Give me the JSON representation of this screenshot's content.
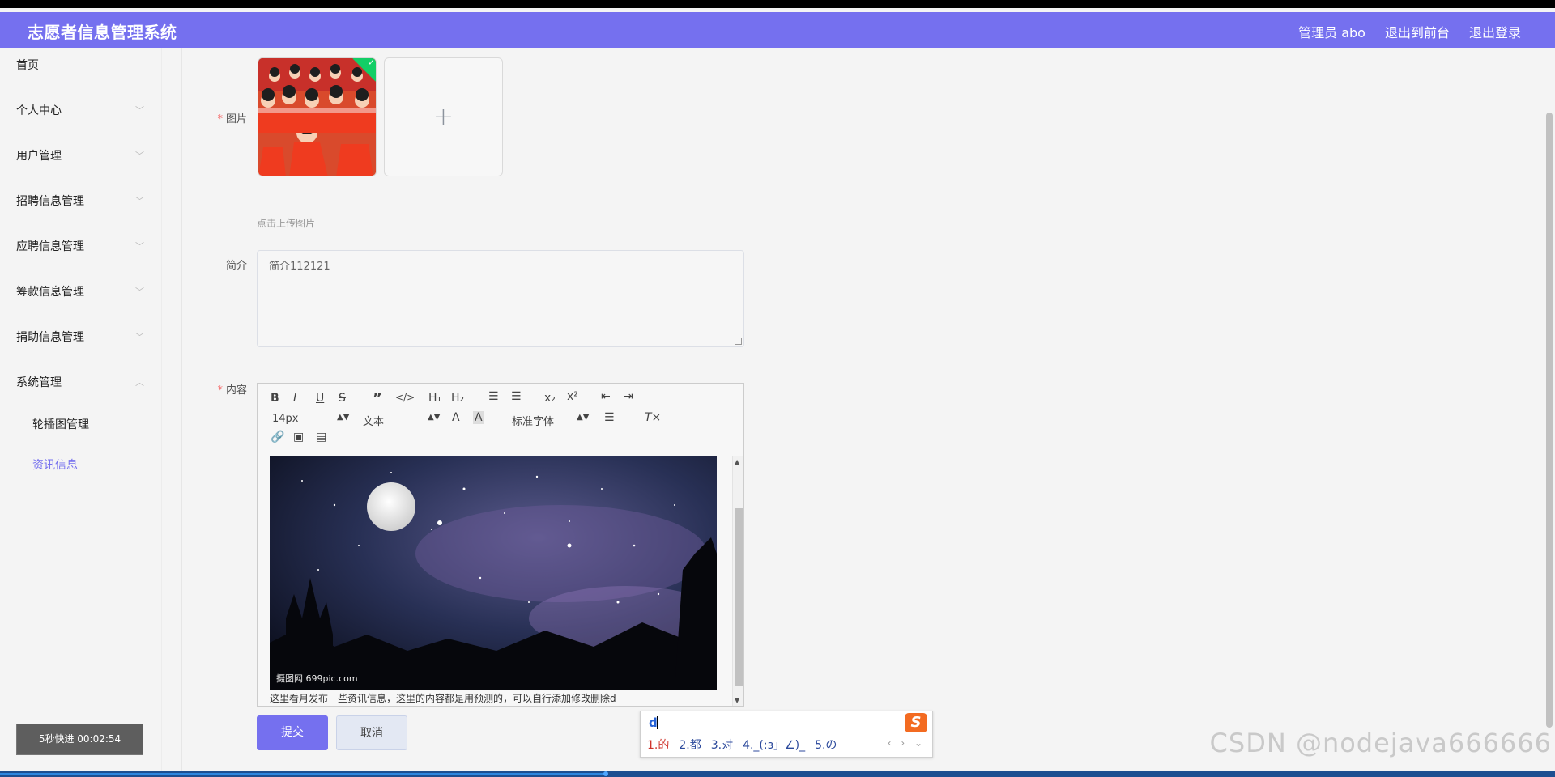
{
  "header": {
    "title": "志愿者信息管理系统",
    "admin": "管理员 abo",
    "to_frontend": "退出到前台",
    "logout": "退出登录"
  },
  "sidebar": {
    "items": [
      {
        "label": "首页"
      },
      {
        "label": "个人中心"
      },
      {
        "label": "用户管理"
      },
      {
        "label": "招聘信息管理"
      },
      {
        "label": "应聘信息管理"
      },
      {
        "label": "筹款信息管理"
      },
      {
        "label": "捐助信息管理"
      },
      {
        "label": "系统管理"
      },
      {
        "label": "轮播图管理"
      },
      {
        "label": "资讯信息"
      }
    ]
  },
  "timer": "5秒快进    00:02:54",
  "form": {
    "image_label": "图片",
    "upload_tip": "点击上传图片",
    "uploader_plus": "+",
    "intro_label": "简介",
    "intro_value": "简介112121",
    "content_label": "内容",
    "required_mark": "*"
  },
  "editor": {
    "font_size": "14px",
    "paragraph": "文本",
    "font_family": "标准字体",
    "image_watermark": "摄图网 699pic.com",
    "caption": "这里看月发布一些资讯信息，这里的内容都是用预测的，可以自行添加修改删除d"
  },
  "buttons": {
    "submit": "提交",
    "cancel": "取消"
  },
  "ime": {
    "typed": "d",
    "candidates": [
      "1.的",
      "2.都",
      "3.对",
      "4._(:з」∠)_",
      "5.の"
    ],
    "logo": "S"
  },
  "watermark": "CSDN @nodejava666666"
}
